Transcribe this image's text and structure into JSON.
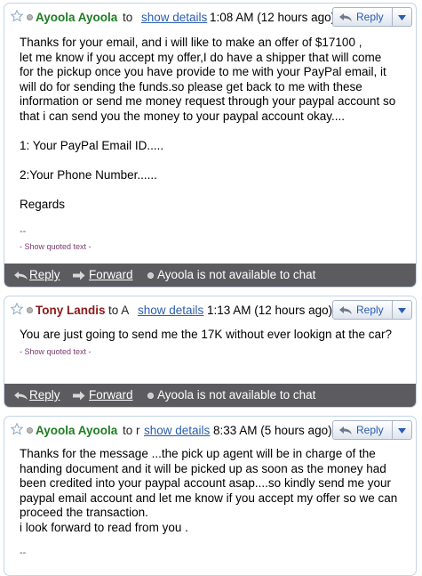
{
  "messages": [
    {
      "sender": "Ayoola Ayoola",
      "sender_color": "#1e7d22",
      "to": "to",
      "show_details": "show details",
      "date": "1:08 AM (12 hours ago)",
      "reply": "Reply",
      "body": [
        "Thanks  for your email, and i will like to make an offer of $17100 ,",
        "let me know if you accept my offer,I do have a shipper that will come",
        "for the pickup once you have provide to me with your PayPal email, it",
        "will do for sending the funds.so please get back to me with these",
        "information or send me money request through your paypal account so",
        "that i can send you the money to your paypal account okay....",
        "",
        "1: Your PayPal Email ID.....",
        "",
        "2:Your Phone Number......",
        "",
        "Regards"
      ],
      "signature": "--",
      "quoted_text": "- Show quoted text -",
      "footer": {
        "reply": "Reply",
        "forward": "Forward",
        "chat_status": "Ayoola is not available to chat"
      }
    },
    {
      "sender": "Tony Landis",
      "sender_color": "#8b1a1a",
      "to": "to A",
      "show_details": "show details",
      "date": "1:13 AM (12 hours ago)",
      "reply": "Reply",
      "body": [
        "You are just going to send me the 17K without ever lookign at the car?"
      ],
      "quoted_text": "- Show quoted text -",
      "footer": {
        "reply": "Reply",
        "forward": "Forward",
        "chat_status": "Ayoola is not available to chat"
      }
    },
    {
      "sender": "Ayoola Ayoola",
      "sender_color": "#1e7d22",
      "to": "to r",
      "show_details": "show details",
      "date": "8:33 AM (5 hours ago)",
      "reply": "Reply",
      "body": [
        "Thanks for the message ...the pick up agent will be in charge of the",
        "handing document and it will be picked up as soon as the money had",
        "been credited into your paypal account asap....so kindly send me your",
        "paypal email account and let me know if you accept my offer so we can",
        "proceed the transaction.",
        "i look forward to read from you ."
      ],
      "signature": "--"
    }
  ]
}
